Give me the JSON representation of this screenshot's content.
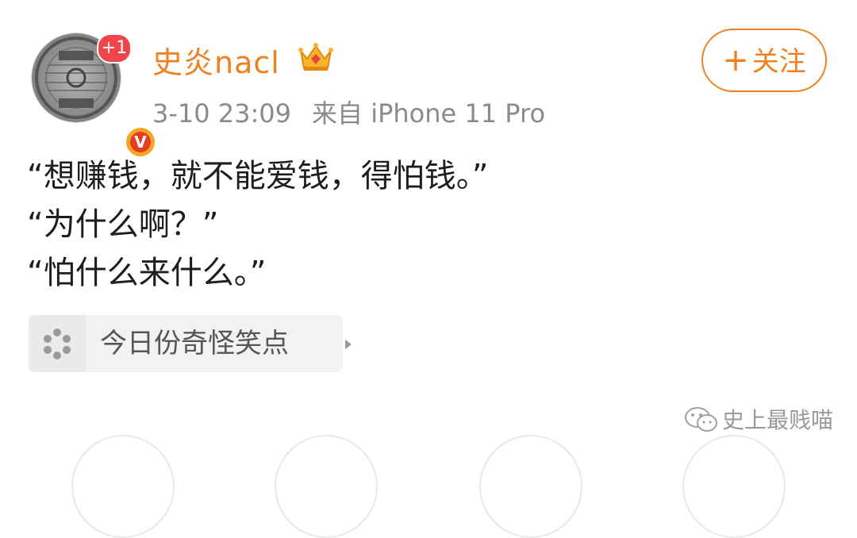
{
  "user": {
    "name": "史炎nacl",
    "avatar_badge": "+1",
    "verified_mark": "V",
    "crown_icon": "crown-icon"
  },
  "post": {
    "timestamp": "3-10 23:09",
    "source": "来自 iPhone 11 Pro",
    "lines": [
      "“想赚钱，就不能爱钱，得怕钱。”",
      "“为什么啊？”",
      "“怕什么来什么。”"
    ]
  },
  "follow_button": {
    "plus": "+",
    "label": "关注"
  },
  "topic": {
    "icon": "topic-icon",
    "label": "今日份奇怪笑点",
    "arrow": "chevron-right-icon"
  },
  "watermark": {
    "icon": "wechat-icon",
    "text": "史上最贱喵"
  },
  "colors": {
    "accent": "#f08020",
    "badge_red": "#f0454a",
    "text_gray": "#8a8a8a"
  }
}
